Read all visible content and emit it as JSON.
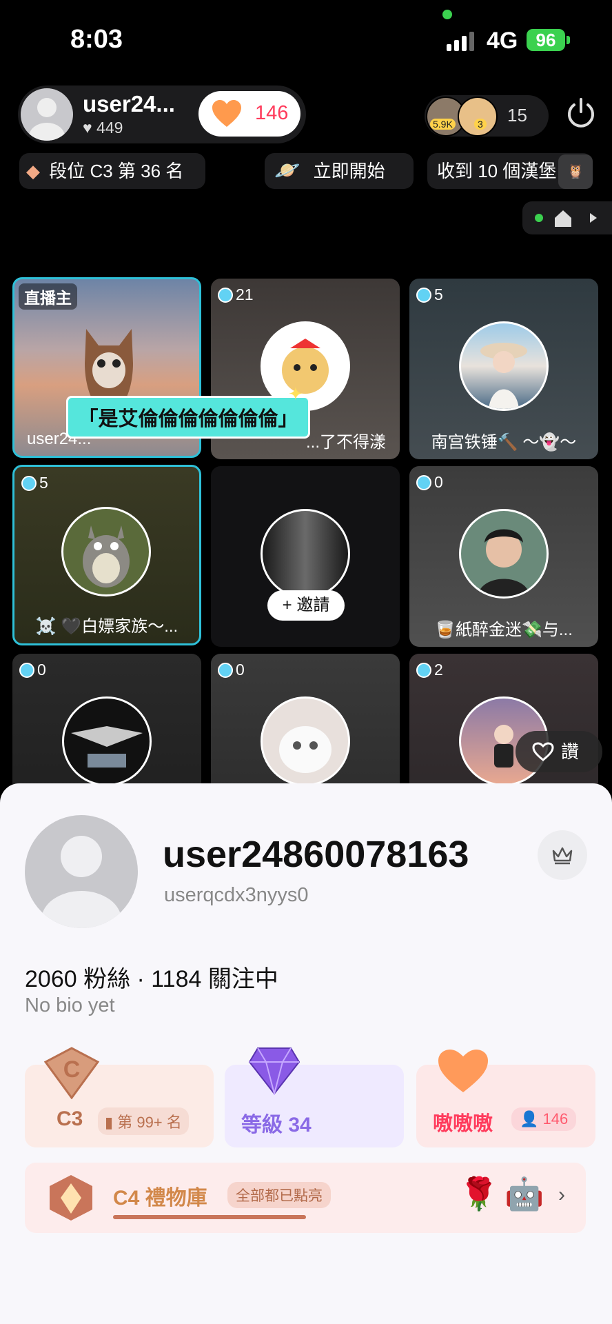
{
  "status_bar": {
    "time": "8:03",
    "network": "4G",
    "battery": "96"
  },
  "host": {
    "name": "user24...",
    "likes": "449",
    "hearts": "146"
  },
  "viewers": {
    "count": "15",
    "badge_1": "5.9K",
    "badge_2": "3"
  },
  "chips": {
    "rank": "段位 C3 第 36 名",
    "start": "立即開始",
    "collect": "收到 10 個漢堡"
  },
  "caption": "「是艾倫倫倫倫倫倫倫」",
  "tiles": [
    {
      "badge": "直播主",
      "name": "user24..."
    },
    {
      "badge": "21",
      "name": "...了不得漾"
    },
    {
      "badge": "5",
      "name": "南宫铁锤🔨 ～👻～"
    },
    {
      "badge": "5",
      "name": "☠️ 🖤白嫖家族～..."
    },
    {
      "badge": "",
      "name": "",
      "invite": "+ 邀請"
    },
    {
      "badge": "0",
      "name": "🥃紙醉金迷💸与..."
    },
    {
      "badge": "0",
      "name": ""
    },
    {
      "badge": "0",
      "name": ""
    },
    {
      "badge": "2",
      "name": ""
    }
  ],
  "like_button": "讚",
  "profile": {
    "name": "user24860078163",
    "handle": "userqcdx3nyys0",
    "stats": "2060 粉絲 · 1184 關注中",
    "bio": "No bio yet"
  },
  "stat_cards": {
    "rank_label": "C3",
    "rank_sub": "第 99+ 名",
    "level_label": "等級 34",
    "fan_label": "嗷嗷嗷",
    "fan_count": "146"
  },
  "gift_library": {
    "title": "C4 禮物庫",
    "badge": "全部都已點亮",
    "progress": 1.0
  },
  "colors": {
    "accent_pink": "#ff3b5c",
    "cyan": "#2ec0d8",
    "level_purple": "#8a6ae6",
    "rank_bronze": "#b9704f"
  }
}
